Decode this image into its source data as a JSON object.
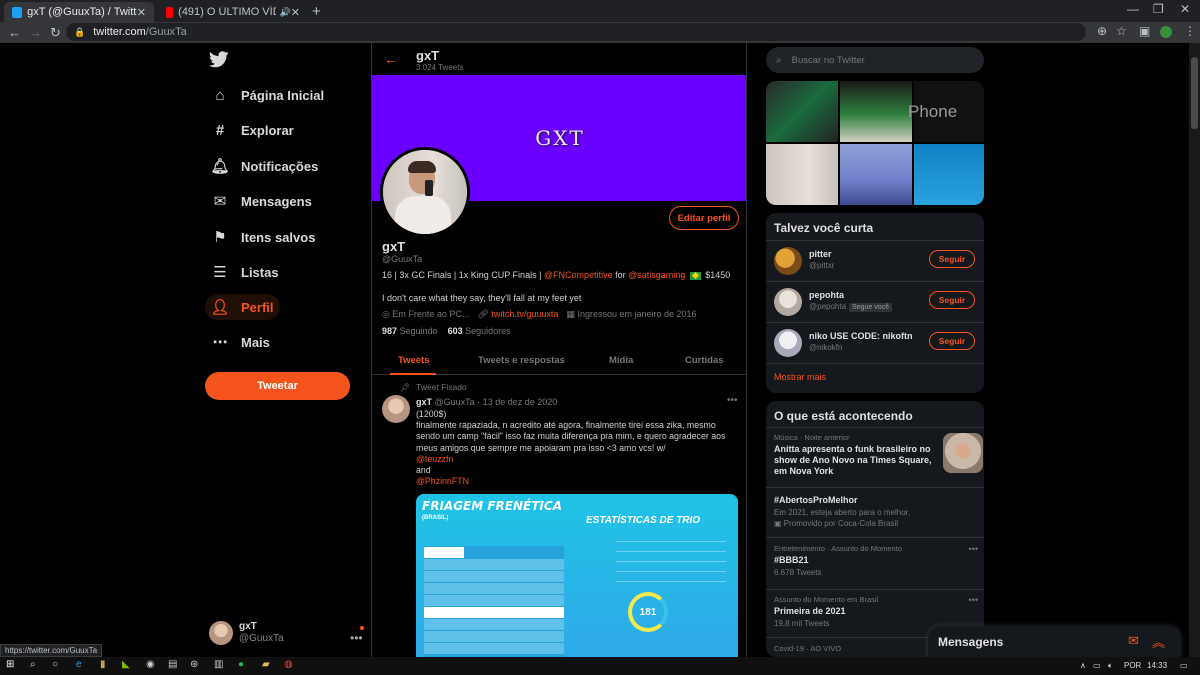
{
  "browser": {
    "tabs": [
      {
        "title": "gxT (@GuuxTa) / Twitter",
        "active": true
      },
      {
        "title": "(491) O ÚLTIMO VÍDEO... - Yo",
        "active": false
      }
    ],
    "url_host": "twitter.com",
    "url_path": "/GuuxTa",
    "status_url": "https://twitter.com/GuuxTa"
  },
  "nav": {
    "items": [
      {
        "label": "Página Inicial",
        "icon": "home-icon"
      },
      {
        "label": "Explorar",
        "icon": "hashtag-icon"
      },
      {
        "label": "Notificações",
        "icon": "bell-icon"
      },
      {
        "label": "Mensagens",
        "icon": "mail-icon"
      },
      {
        "label": "Itens salvos",
        "icon": "bookmark-icon"
      },
      {
        "label": "Listas",
        "icon": "list-icon"
      },
      {
        "label": "Perfil",
        "icon": "person-icon"
      },
      {
        "label": "Mais",
        "icon": "more-icon"
      }
    ],
    "tweet_button": "Tweetar",
    "account": {
      "name": "gxT",
      "handle": "@GuuxTa"
    }
  },
  "profile": {
    "header_name": "gxT",
    "tweet_count": "3.024 Tweets",
    "banner_text": "GXT",
    "edit_button": "Editar perfil",
    "name": "gxT",
    "handle": "@GuuxTa",
    "bio_prefix": "16 | 3x GC Finals | 1x King CUP Finals | ",
    "bio_mention1": "@FNCompetitive",
    "bio_mid": " for ",
    "bio_mention2": "@satisgaming",
    "bio_suffix": " $1450",
    "quote": "I don't care what they say, they'll fall at my feet yet",
    "location": "Em Frente ao PC...",
    "website": "twitch.tv/guuuxta",
    "joined": "Ingressou em janeiro de 2016",
    "following_count": "987",
    "following_label": "Seguindo",
    "followers_count": "603",
    "followers_label": "Seguidores",
    "tabs": [
      "Tweets",
      "Tweets e respostas",
      "Mídia",
      "Curtidas"
    ]
  },
  "pinned_tweet": {
    "pinned_label": "Tweet Fixado",
    "author": "gxT",
    "meta": "@GuuxTa · 13 de dez de 2020",
    "line1": "(1200$)",
    "text": "finalmente rapaziada, n acredito até agora, finalmente tirei essa zika, mesmo sendo um camp \"fácil\" isso faz muita diferença pra mim, e quero agradecer aos meus amigos que sempre me apoiaram pra isso <3 amo vcs! w/",
    "mention1": "@teuzzfn",
    "and": " and",
    "mention2": "@PhzinnFTN",
    "image_title": "FRIAGEM FRENÉTICA",
    "image_subtitle": "(BRASIL)",
    "image_stats_title": "ESTATÍSTICAS DE TRIO",
    "image_score": "181"
  },
  "right": {
    "search_placeholder": "Buscar no Twitter",
    "media_text": "Phone",
    "who_to_follow_title": "Talvez você curta",
    "who_to_follow": [
      {
        "name": "pitter",
        "handle": "@pittxr",
        "badge": "",
        "button": "Seguir"
      },
      {
        "name": "pepohta",
        "handle": "@pepohta",
        "badge": "Segue você",
        "button": "Seguir"
      },
      {
        "name": "niko USE CODE: nikoftn",
        "handle": "@nikokfn",
        "badge": "",
        "button": "Seguir"
      }
    ],
    "show_more": "Mostrar mais",
    "trends_title": "O que está acontecendo",
    "trends": [
      {
        "context": "Música · Noite anterior",
        "title": "Anitta apresenta o funk brasileiro no show de Ano Novo na Times Square, em Nova York",
        "sub": ""
      },
      {
        "context": "",
        "title": "#AbertosProMelhor",
        "sub": "Em 2021, esteja aberto para o melhor.",
        "promo": "Promovido por Coca-Cola Brasil"
      },
      {
        "context": "Entretenimento · Assunto do Momento",
        "title": "#BBB21",
        "sub": "6.678 Tweets"
      },
      {
        "context": "Assunto do Momento em Brasil",
        "title": "Primeira de 2021",
        "sub": "19,8 mil Tweets"
      },
      {
        "context": "Covid-19 · AO VIVO",
        "title": "",
        "sub": ""
      }
    ],
    "messages_drawer": "Mensagens"
  },
  "taskbar": {
    "lang": "POR",
    "time": "14:33"
  },
  "colors": {
    "accent": "#f4541b",
    "banner": "#6a00ff",
    "background": "#000000"
  }
}
